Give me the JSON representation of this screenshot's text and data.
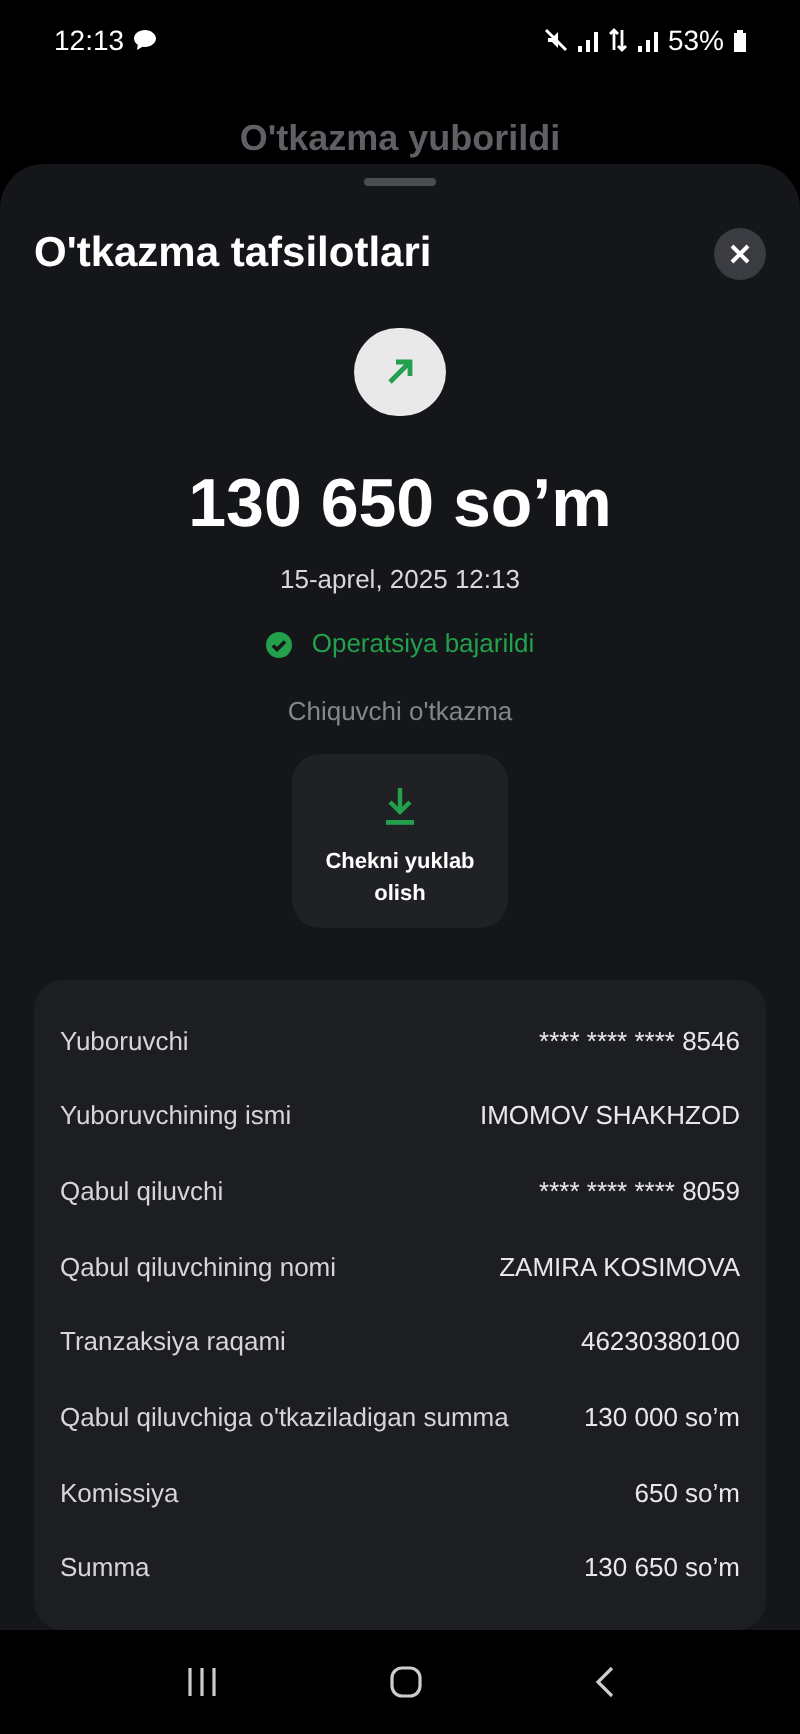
{
  "status_bar": {
    "time": "12:13",
    "battery": "53%"
  },
  "background_title": "O'tkazma yuborildi",
  "sheet": {
    "title": "O'tkazma tafsilotlari",
    "amount": "130 650 so’m",
    "date": "15-aprel, 2025 12:13",
    "status": "Operatsiya bajarildi",
    "type": "Chiquvchi o'tkazma",
    "download_button": "Chekni yuklab olish"
  },
  "details": [
    {
      "label": "Yuboruvchi",
      "value": "**** **** **** 8546"
    },
    {
      "label": "Yuboruvchining ismi",
      "value": "IMOMOV SHAKHZOD"
    },
    {
      "label": "Qabul qiluvchi",
      "value": "**** **** **** 8059"
    },
    {
      "label": "Qabul qiluvchining nomi",
      "value": "ZAMIRA KOSIMOVA"
    },
    {
      "label": "Tranzaksiya raqami",
      "value": "46230380100"
    },
    {
      "label": "Qabul qiluvchiga o'tkaziladigan summa",
      "value": "130 000 so’m"
    },
    {
      "label": "Komissiya",
      "value": "650 so’m"
    },
    {
      "label": "Summa",
      "value": "130 650 so’m"
    }
  ]
}
